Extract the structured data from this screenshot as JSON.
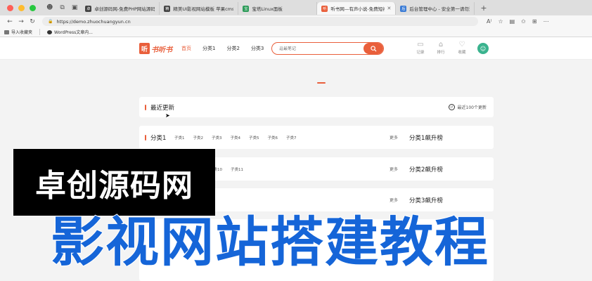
{
  "browser": {
    "tabs": [
      {
        "title": "卓创源码网-免费PHP网站源码分…",
        "favicon": "卓",
        "color": "#444444"
      },
      {
        "title": "精美UI影视网站模板 苹果cms(影…",
        "favicon": "精",
        "color": "#444444"
      },
      {
        "title": "宝塔Linux面板",
        "favicon": "宝",
        "color": "#2e9c5a"
      },
      {
        "title": "听书网—有声小说-免费短视频分…",
        "favicon": "听",
        "color": "#e95f3b"
      },
      {
        "title": "后台管理中心 - 安全第一请勿泄露…",
        "favicon": "后",
        "color": "#3a7bd5"
      }
    ],
    "active_tab": 3,
    "new_tab": "+",
    "url": "https://demo.zhuochuangyun.cn",
    "bookmarks": [
      "导入收藏夹",
      "WordPress文章内..."
    ]
  },
  "site": {
    "logo_mark": "听",
    "logo_text": "书听书",
    "nav": [
      "首页",
      "分类1",
      "分类2",
      "分类3"
    ],
    "search_placeholder": "逗最笔记",
    "header_icons": [
      {
        "icon": "history-icon",
        "label": "记录"
      },
      {
        "icon": "rank-icon",
        "label": "排行"
      },
      {
        "icon": "favorite-icon",
        "label": "收藏"
      }
    ]
  },
  "sections": {
    "latest": {
      "title": "最近更新",
      "link": "最近100个更新"
    },
    "cat1": {
      "title": "分类1",
      "subs": [
        "子类1",
        "子类2",
        "子类3",
        "子类4",
        "子类5",
        "子类6",
        "子类7"
      ],
      "more": "更多",
      "rank": "分类1飙升榜"
    },
    "cat2": {
      "subs": [
        "子类10",
        "子类11"
      ],
      "more": "更多",
      "rank": "分类2飙升榜"
    },
    "cat3": {
      "more": "更多",
      "rank": "分类3飙升榜"
    }
  },
  "overlay": {
    "brand": "卓创源码网",
    "title": "影视网站搭建教程"
  },
  "colors": {
    "accent": "#e95f3b",
    "overlay_blue": "#1565d8"
  }
}
